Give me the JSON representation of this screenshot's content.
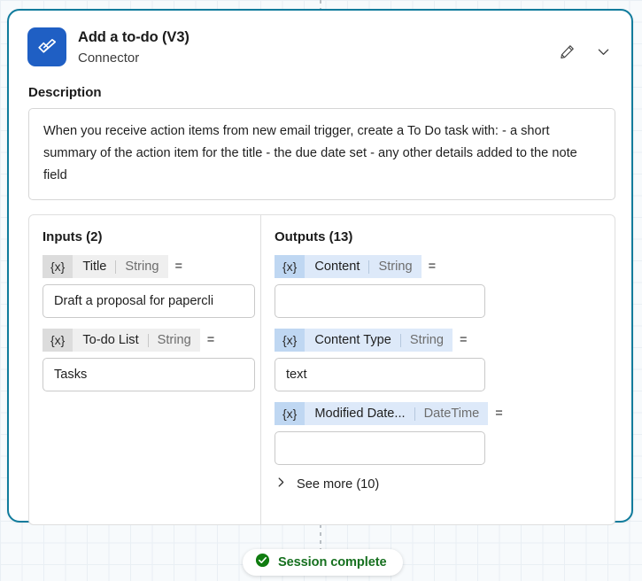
{
  "canvas": {
    "background_color": "#f7fafc",
    "grid_color": "#e9eff4"
  },
  "card": {
    "border_color": "#0f7b9c",
    "header": {
      "icon": "checkmark-badge-icon",
      "icon_bg": "#1f5fc4",
      "title": "Add a to-do (V3)",
      "subtitle": "Connector",
      "edit_icon": "pencil-icon",
      "collapse_icon": "chevron-down-icon"
    },
    "description": {
      "label": "Description",
      "text": "When you receive action items from new email trigger, create a To Do task with: - a short summary of the action item for the title - the due date set - any other details added to the note field"
    },
    "inputs": {
      "heading": "Inputs (2)",
      "chip_bg": "#efefef",
      "chip_token_bg": "#dcdcdc",
      "token": "{x}",
      "equals": "=",
      "rows": [
        {
          "name": "Title",
          "type": "String",
          "value": "Draft a proposal for papercli"
        },
        {
          "name": "To-do List",
          "type": "String",
          "value": "Tasks"
        }
      ]
    },
    "outputs": {
      "heading": "Outputs (13)",
      "chip_bg": "#dde9f9",
      "chip_token_bg": "#bfd7f2",
      "token": "{x}",
      "equals": "=",
      "rows": [
        {
          "name": "Content",
          "type": "String",
          "value": ""
        },
        {
          "name": "Content Type",
          "type": "String",
          "value": "text"
        },
        {
          "name": "Modified Date...",
          "type": "DateTime",
          "value": ""
        }
      ],
      "see_more": {
        "label": "See more (10)",
        "icon": "chevron-right-icon"
      }
    }
  },
  "status_pill": {
    "icon": "check-circle-icon",
    "icon_color": "#107c10",
    "label": "Session complete",
    "label_color": "#16701f"
  }
}
